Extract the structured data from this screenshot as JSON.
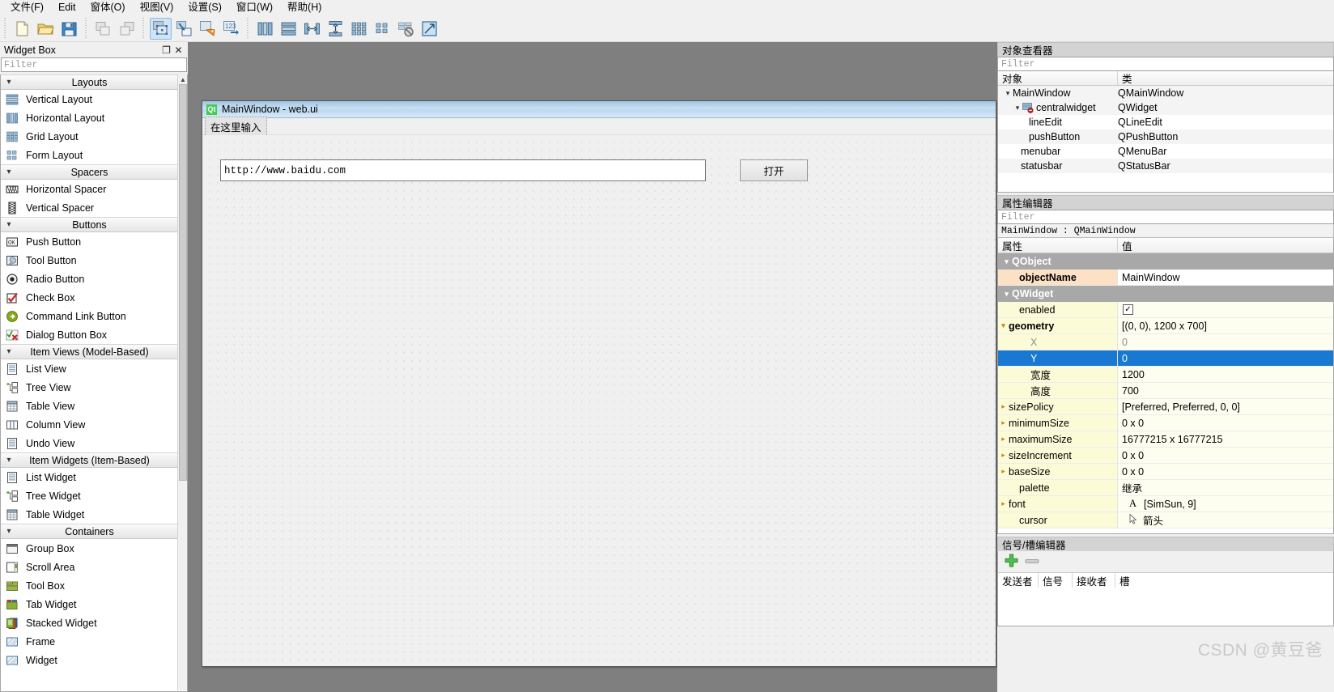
{
  "menubar": {
    "items": [
      {
        "label": "文件(F)",
        "mnemonic": "F"
      },
      {
        "label": "Edit",
        "mnemonic": "E"
      },
      {
        "label": "窗体(O)",
        "mnemonic": "O"
      },
      {
        "label": "视图(V)",
        "mnemonic": "V"
      },
      {
        "label": "设置(S)",
        "mnemonic": "S"
      },
      {
        "label": "窗口(W)",
        "mnemonic": "W"
      },
      {
        "label": "帮助(H)",
        "mnemonic": "H"
      }
    ]
  },
  "toolbar": {
    "groups": [
      [
        "new-file-icon",
        "open-folder-icon",
        "save-icon"
      ],
      [
        "undo-icon",
        "redo-icon"
      ],
      [
        "edit-widgets-icon",
        "edit-signals-slots-icon",
        "edit-buddies-icon",
        "edit-tab-order-icon"
      ],
      [
        "layout-horizontally-icon",
        "layout-vertically-icon",
        "layout-in-splitter-h-icon",
        "layout-in-splitter-v-icon",
        "layout-grid-icon",
        "layout-form-icon",
        "break-layout-icon",
        "adjust-size-icon"
      ]
    ],
    "active": "edit-widgets-icon"
  },
  "widget_box": {
    "title": "Widget Box",
    "float_button": "❐",
    "close_button": "✕",
    "filter_placeholder": "Filter",
    "categories": [
      {
        "name": "Layouts",
        "expanded": true,
        "items": [
          {
            "label": "Vertical Layout",
            "icon": "vertical-layout-icon"
          },
          {
            "label": "Horizontal Layout",
            "icon": "horizontal-layout-icon"
          },
          {
            "label": "Grid Layout",
            "icon": "grid-layout-icon"
          },
          {
            "label": "Form Layout",
            "icon": "form-layout-icon"
          }
        ]
      },
      {
        "name": "Spacers",
        "expanded": true,
        "items": [
          {
            "label": "Horizontal Spacer",
            "icon": "horizontal-spacer-icon"
          },
          {
            "label": "Vertical Spacer",
            "icon": "vertical-spacer-icon"
          }
        ]
      },
      {
        "name": "Buttons",
        "expanded": true,
        "items": [
          {
            "label": "Push Button",
            "icon": "push-button-icon"
          },
          {
            "label": "Tool Button",
            "icon": "tool-button-icon"
          },
          {
            "label": "Radio Button",
            "icon": "radio-button-icon"
          },
          {
            "label": "Check Box",
            "icon": "check-box-icon"
          },
          {
            "label": "Command Link Button",
            "icon": "command-link-button-icon"
          },
          {
            "label": "Dialog Button Box",
            "icon": "dialog-button-box-icon"
          }
        ]
      },
      {
        "name": "Item Views (Model-Based)",
        "expanded": true,
        "items": [
          {
            "label": "List View",
            "icon": "list-view-icon"
          },
          {
            "label": "Tree View",
            "icon": "tree-view-icon"
          },
          {
            "label": "Table View",
            "icon": "table-view-icon"
          },
          {
            "label": "Column View",
            "icon": "column-view-icon"
          },
          {
            "label": "Undo View",
            "icon": "undo-view-icon"
          }
        ]
      },
      {
        "name": "Item Widgets (Item-Based)",
        "expanded": true,
        "items": [
          {
            "label": "List Widget",
            "icon": "list-widget-icon"
          },
          {
            "label": "Tree Widget",
            "icon": "tree-widget-icon"
          },
          {
            "label": "Table Widget",
            "icon": "table-widget-icon"
          }
        ]
      },
      {
        "name": "Containers",
        "expanded": true,
        "items": [
          {
            "label": "Group Box",
            "icon": "group-box-icon"
          },
          {
            "label": "Scroll Area",
            "icon": "scroll-area-icon"
          },
          {
            "label": "Tool Box",
            "icon": "tool-box-icon"
          },
          {
            "label": "Tab Widget",
            "icon": "tab-widget-icon"
          },
          {
            "label": "Stacked Widget",
            "icon": "stacked-widget-icon"
          },
          {
            "label": "Frame",
            "icon": "frame-icon"
          },
          {
            "label": "Widget",
            "icon": "widget-icon"
          }
        ]
      }
    ]
  },
  "form": {
    "title": "MainWindow - web.ui",
    "logo_text": "Qt",
    "menu_placeholder": "在这里输入",
    "line_edit_value": "http://www.baidu.com",
    "push_button_label": "打开"
  },
  "object_inspector": {
    "title": "对象查看器",
    "filter_placeholder": "Filter",
    "columns": [
      "对象",
      "类"
    ],
    "rows": [
      {
        "object": "MainWindow",
        "class": "QMainWindow",
        "depth": 0,
        "expander": "▾",
        "icon": false
      },
      {
        "object": "centralwidget",
        "class": "QWidget",
        "depth": 1,
        "expander": "▾",
        "icon": true
      },
      {
        "object": "lineEdit",
        "class": "QLineEdit",
        "depth": 2,
        "expander": "",
        "icon": false
      },
      {
        "object": "pushButton",
        "class": "QPushButton",
        "depth": 2,
        "expander": "",
        "icon": false
      },
      {
        "object": "menubar",
        "class": "QMenuBar",
        "depth": 1,
        "expander": "",
        "icon": false
      },
      {
        "object": "statusbar",
        "class": "QStatusBar",
        "depth": 1,
        "expander": "",
        "icon": false
      }
    ]
  },
  "property_editor": {
    "title": "属性编辑器",
    "filter_placeholder": "Filter",
    "subject": "MainWindow : QMainWindow",
    "columns": [
      "属性",
      "值"
    ],
    "rows": [
      {
        "name": "QObject",
        "value": "",
        "kind": "group",
        "expander": "▾"
      },
      {
        "name": "objectName",
        "value": "MainWindow",
        "kind": "bold-orange",
        "expander": "",
        "indent": 1
      },
      {
        "name": "QWidget",
        "value": "",
        "kind": "group",
        "expander": "▾"
      },
      {
        "name": "enabled",
        "value": "",
        "kind": "checkbox",
        "checked": true,
        "expander": "",
        "indent": 1
      },
      {
        "name": "geometry",
        "value": "[(0, 0), 1200 x 700]",
        "kind": "bold",
        "expander": "▾",
        "indent": 0
      },
      {
        "name": "X",
        "value": "0",
        "kind": "sub-gray",
        "expander": "",
        "indent": 2
      },
      {
        "name": "Y",
        "value": "0",
        "kind": "selected",
        "expander": "",
        "indent": 2
      },
      {
        "name": "宽度",
        "value": "1200",
        "kind": "sub",
        "expander": "",
        "indent": 2
      },
      {
        "name": "高度",
        "value": "700",
        "kind": "sub",
        "expander": "",
        "indent": 2
      },
      {
        "name": "sizePolicy",
        "value": "[Preferred, Preferred, 0, 0]",
        "kind": "normal",
        "expander": "▸",
        "indent": 0
      },
      {
        "name": "minimumSize",
        "value": "0 x 0",
        "kind": "normal",
        "expander": "▸",
        "indent": 0
      },
      {
        "name": "maximumSize",
        "value": "16777215 x 16777215",
        "kind": "normal",
        "expander": "▸",
        "indent": 0
      },
      {
        "name": "sizeIncrement",
        "value": "0 x 0",
        "kind": "normal",
        "expander": "▸",
        "indent": 0
      },
      {
        "name": "baseSize",
        "value": "0 x 0",
        "kind": "normal",
        "expander": "▸",
        "indent": 0
      },
      {
        "name": "palette",
        "value": "继承",
        "kind": "normal",
        "expander": "",
        "indent": 1
      },
      {
        "name": "font",
        "value": "[SimSun, 9]",
        "kind": "font",
        "expander": "▸",
        "indent": 0
      },
      {
        "name": "cursor",
        "value": "箭头",
        "kind": "cursor",
        "expander": "",
        "indent": 1
      }
    ]
  },
  "signal_slot_editor": {
    "title": "信号/槽编辑器",
    "add_button": "add-icon",
    "remove_button": "remove-icon",
    "columns": [
      "发送者",
      "信号",
      "接收者",
      "槽"
    ]
  },
  "watermark": "CSDN @黄豆爸",
  "colors": {
    "accent": "#1878d2",
    "group_header": "#a8a8a8",
    "property_yellow": "#fcfbd8",
    "property_orange": "#fde1c4",
    "qt_green": "#41cd52",
    "canvas_gray": "#7f7f7f"
  }
}
